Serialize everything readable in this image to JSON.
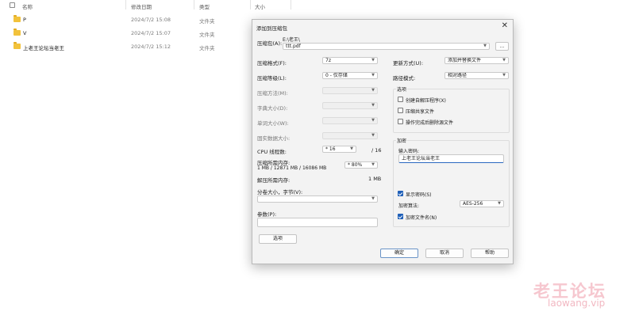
{
  "explorer": {
    "columns": {
      "name": "名称",
      "modified": "修改日期",
      "type": "类型",
      "size": "大小"
    },
    "rows": [
      {
        "name": "P",
        "modified": "2024/7/2 15:08",
        "type": "文件夹"
      },
      {
        "name": "V",
        "modified": "2024/7/2 15:07",
        "type": "文件夹"
      },
      {
        "name": "上老王论坛当老王",
        "modified": "2024/7/2 15:12",
        "type": "文件夹"
      }
    ]
  },
  "dialog": {
    "title": "添加到压缩包",
    "close_glyph": "✕",
    "archive_label": "压缩包(A):",
    "archive_path": "E:\\老王\\",
    "archive_name": "ttt.pdf",
    "browse_label": "...",
    "left": {
      "format_label": "压缩格式(F):",
      "format_value": "7z",
      "level_label": "压缩等级(L):",
      "level_value": "0 - 仅存储",
      "method_label": "压缩方法(M):",
      "dict_label": "字典大小(D):",
      "word_label": "单词大小(W):",
      "solid_label": "固实数据大小:",
      "threads_label": "CPU 线程数:",
      "threads_value": "* 16",
      "threads_max": "/ 16",
      "mem_compress_label": "压缩所需内存:",
      "mem_compress_detail": "1 MB / 12871 MB / 16086 MB",
      "mem_percent": "* 80%",
      "mem_decompress_label": "解压所需内存:",
      "mem_decompress_value": "1 MB",
      "split_label": "分卷大小，字节(V):",
      "params_label": "参数(P):",
      "options_button": "选项"
    },
    "right": {
      "update_label": "更新方式(U):",
      "update_value": "添加并替换文件",
      "pathmode_label": "路径模式:",
      "pathmode_value": "相对路径",
      "options_group": "选项",
      "opt_sfx": "创建自解压程序(X)",
      "opt_shared": "压缩共享文件",
      "opt_delete": "操作完成后删除源文件",
      "encrypt_group": "加密",
      "password_label": "输入密码:",
      "password_value": "上老王论坛当老王",
      "show_password": "显示密码(S)",
      "enc_method_label": "加密算法:",
      "enc_method_value": "AES-256",
      "encrypt_names": "加密文件名(N)"
    },
    "buttons": {
      "ok": "确定",
      "cancel": "取消",
      "help": "帮助"
    }
  },
  "watermark": {
    "logo": "老王论坛",
    "url": "laowang.vip"
  }
}
